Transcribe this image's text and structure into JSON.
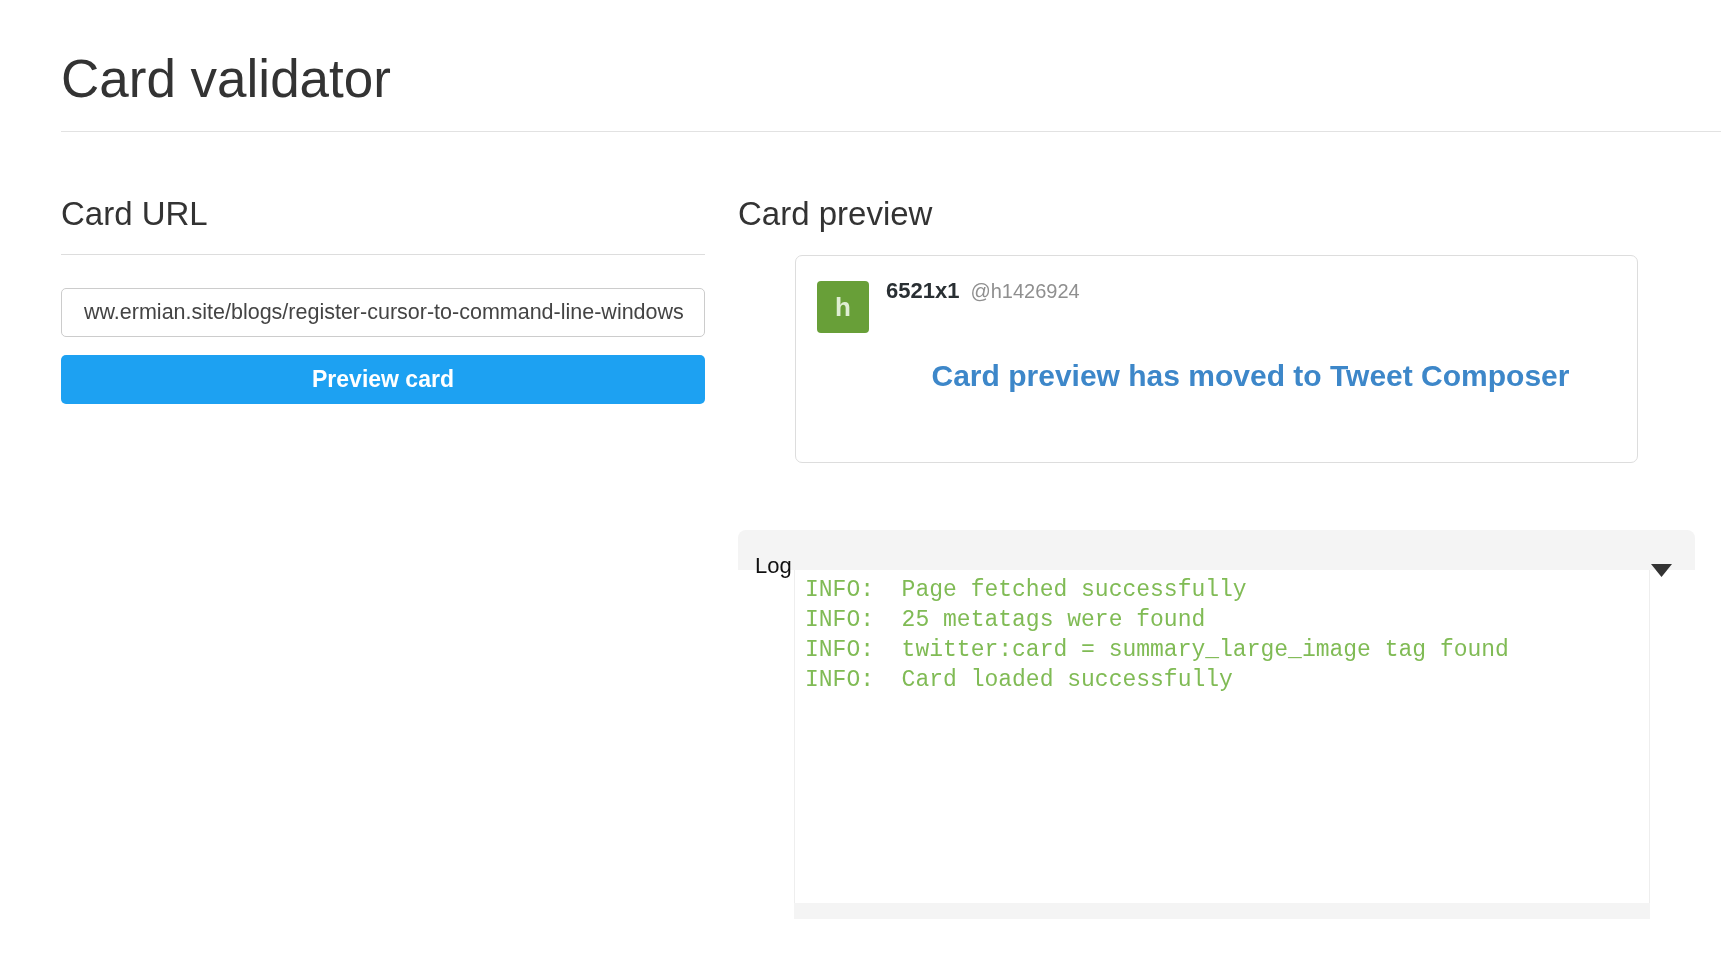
{
  "page": {
    "title": "Card validator"
  },
  "card_url": {
    "heading": "Card URL",
    "url_field": {
      "value": "ww.ermian.site/blogs/register-cursor-to-command-line-windows"
    },
    "button": "Preview card"
  },
  "card_preview": {
    "heading": "Card preview",
    "author": {
      "avatar_letter": "h",
      "name": "6521x1",
      "handle": "@h1426924"
    },
    "message": "Card preview has moved to Tweet Composer"
  },
  "log": {
    "title": "Log",
    "expanded": true,
    "lines": [
      "INFO:  Page fetched successfully",
      "INFO:  25 metatags were found",
      "INFO:  twitter:card = summary_large_image tag found",
      "INFO:  Card loaded successfully"
    ]
  }
}
